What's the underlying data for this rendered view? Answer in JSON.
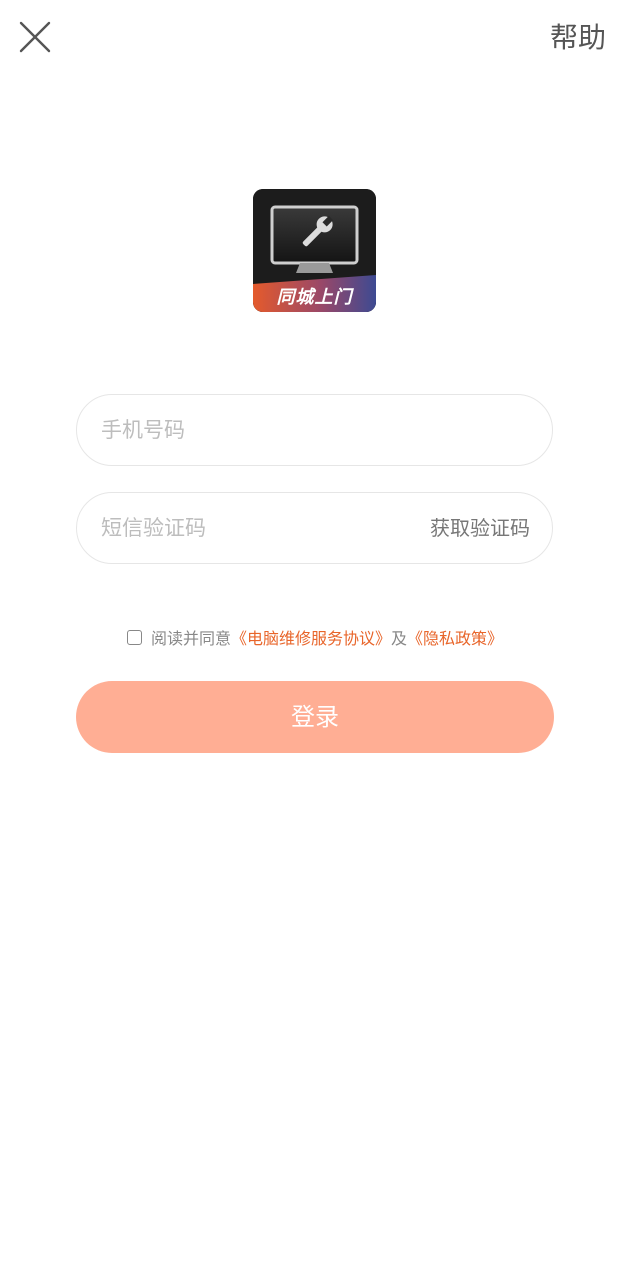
{
  "header": {
    "close_icon": "close-icon",
    "help_label": "帮助"
  },
  "logo": {
    "text": "同城上门",
    "icon": "monitor-wrench-icon"
  },
  "form": {
    "phone_placeholder": "手机号码",
    "phone_value": "",
    "code_placeholder": "短信验证码",
    "code_value": "",
    "get_code_label": "获取验证码"
  },
  "agreement": {
    "checked": false,
    "prefix": "阅读并同意",
    "service_link": "《电脑维修服务协议》",
    "connector": "及",
    "privacy_link": "《隐私政策》"
  },
  "login": {
    "label": "登录"
  },
  "colors": {
    "accent": "#e8652a",
    "button_bg": "#ffae94",
    "placeholder": "#bdbdbd"
  }
}
